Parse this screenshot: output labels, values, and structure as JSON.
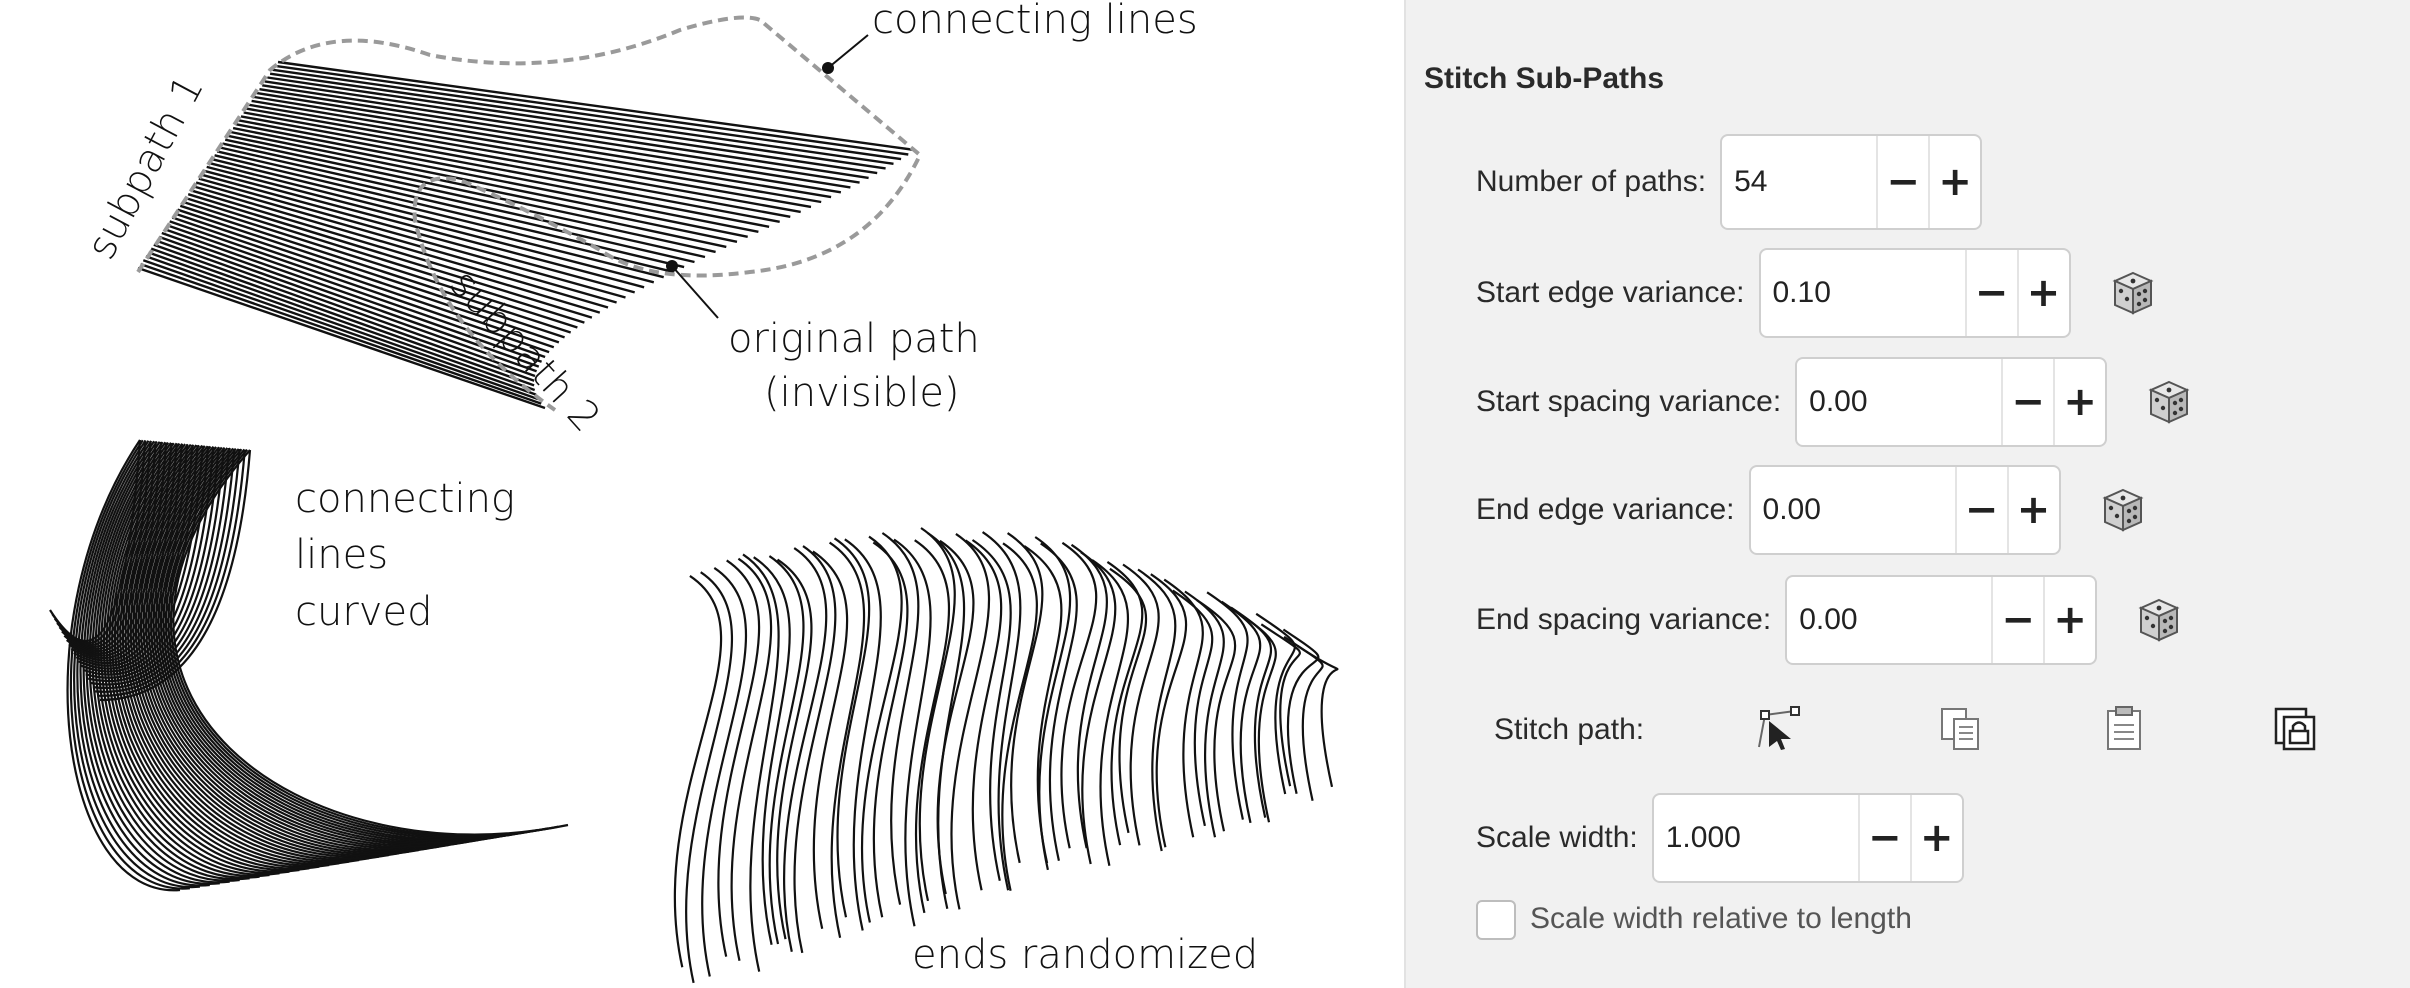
{
  "annotations": {
    "connecting_lines": "connecting lines",
    "subpath_1": "subpath 1",
    "subpath_2": "subpath 2",
    "original_path_line1": "original path",
    "original_path_line2": "(invisible)",
    "curved_line1": "connecting",
    "curved_line2": "lines",
    "curved_line3": "curved",
    "ends_randomized": "ends randomized"
  },
  "panel": {
    "title": "Stitch Sub-Paths",
    "number_of_paths": {
      "label": "Number of paths:",
      "value": "54"
    },
    "start_edge_variance": {
      "label": "Start edge variance:",
      "value": "0.10"
    },
    "start_spacing_variance": {
      "label": "Start spacing variance:",
      "value": "0.00"
    },
    "end_edge_variance": {
      "label": "End edge variance:",
      "value": "0.00"
    },
    "end_spacing_variance": {
      "label": "End spacing variance:",
      "value": "0.00"
    },
    "stitch_path": {
      "label": "Stitch path:",
      "icons": [
        "node-edit-icon",
        "copy-path-icon",
        "paste-path-icon",
        "link-clipboard-icon"
      ]
    },
    "scale_width": {
      "label": "Scale width:",
      "value": "1.000"
    },
    "scale_relative": {
      "label": "Scale width relative to length",
      "checked": false
    },
    "stepper": {
      "minus": "−",
      "plus": "+"
    },
    "random_icon": "dice-icon"
  }
}
